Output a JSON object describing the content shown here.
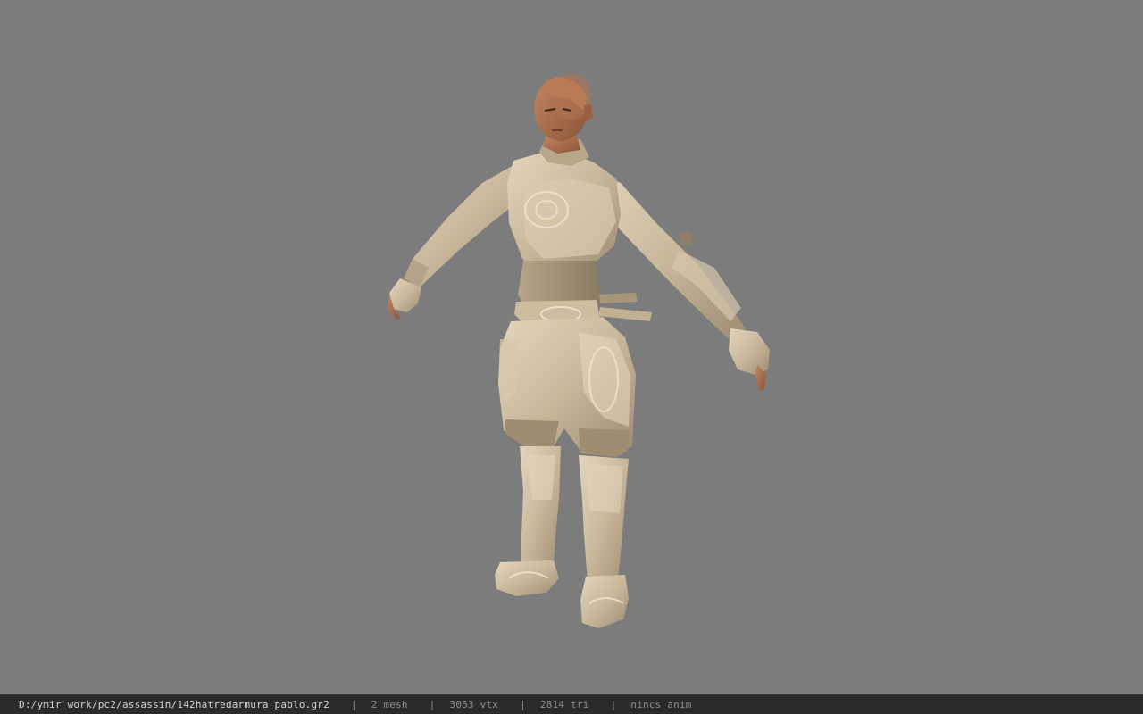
{
  "viewport": {
    "background": "#7c7c7c",
    "model_name": "assassin character model (T-pose)"
  },
  "status_bar": {
    "file_path": "D:/ymir work/pc2/assassin/142hatredarmura_pablo.gr2",
    "separator": "|",
    "mesh_count": "2 mesh",
    "vertex_count": "3053 vtx",
    "triangle_count": "2814 tri",
    "anim": "nincs anim"
  }
}
